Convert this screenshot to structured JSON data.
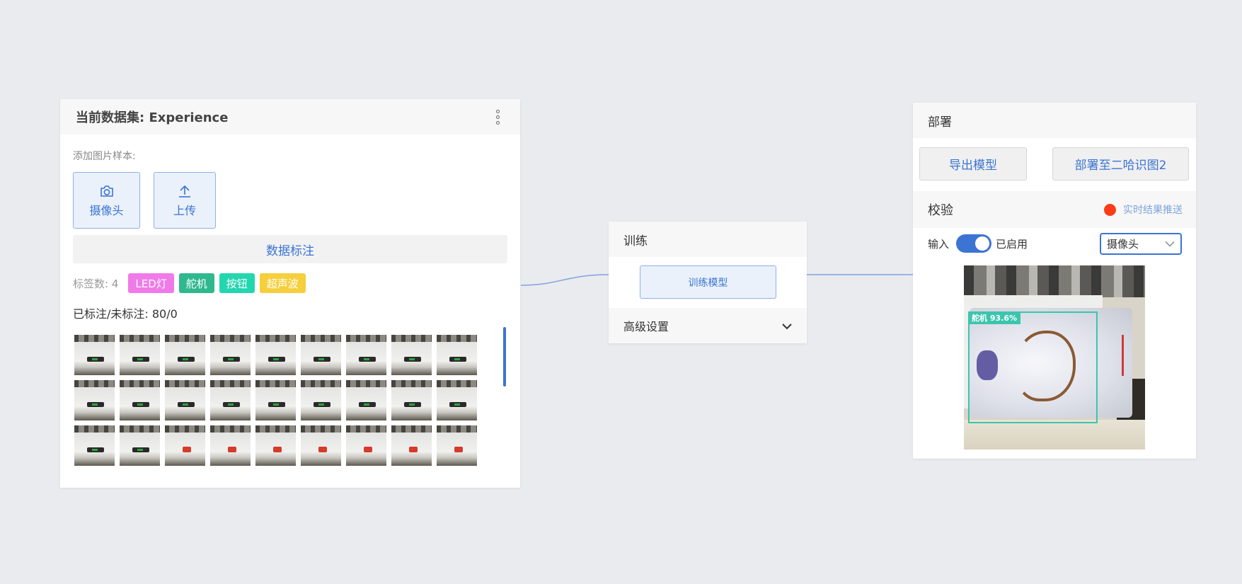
{
  "dataset": {
    "title": "当前数据集: Experience",
    "add_samples_label": "添加图片样本:",
    "camera_button": "摄像头",
    "upload_button": "上传",
    "annotate_button": "数据标注",
    "tag_count_text": "标签数: 4",
    "tags": [
      {
        "label": "LED灯",
        "color": "#f07ae8"
      },
      {
        "label": "舵机",
        "color": "#2fb88e"
      },
      {
        "label": "按钮",
        "color": "#22d6b0"
      },
      {
        "label": "超声波",
        "color": "#f6cf3d"
      }
    ],
    "labeled_stats": "已标注/未标注: 80/0"
  },
  "training": {
    "title": "训练",
    "train_button": "训练模型",
    "advanced_label": "高级设置"
  },
  "deploy": {
    "title": "部署",
    "export_button": "导出模型",
    "deploy_button": "部署至二哈识图2",
    "verify_title": "校验",
    "push_label": "实时结果推送",
    "input_label": "输入",
    "enabled_label": "已启用",
    "input_source": "摄像头",
    "detection_label": "舵机 93.6%"
  },
  "colors": {
    "accent": "#3b74d3",
    "push_dot": "#fb3c16",
    "detection": "#3cc5ad"
  }
}
